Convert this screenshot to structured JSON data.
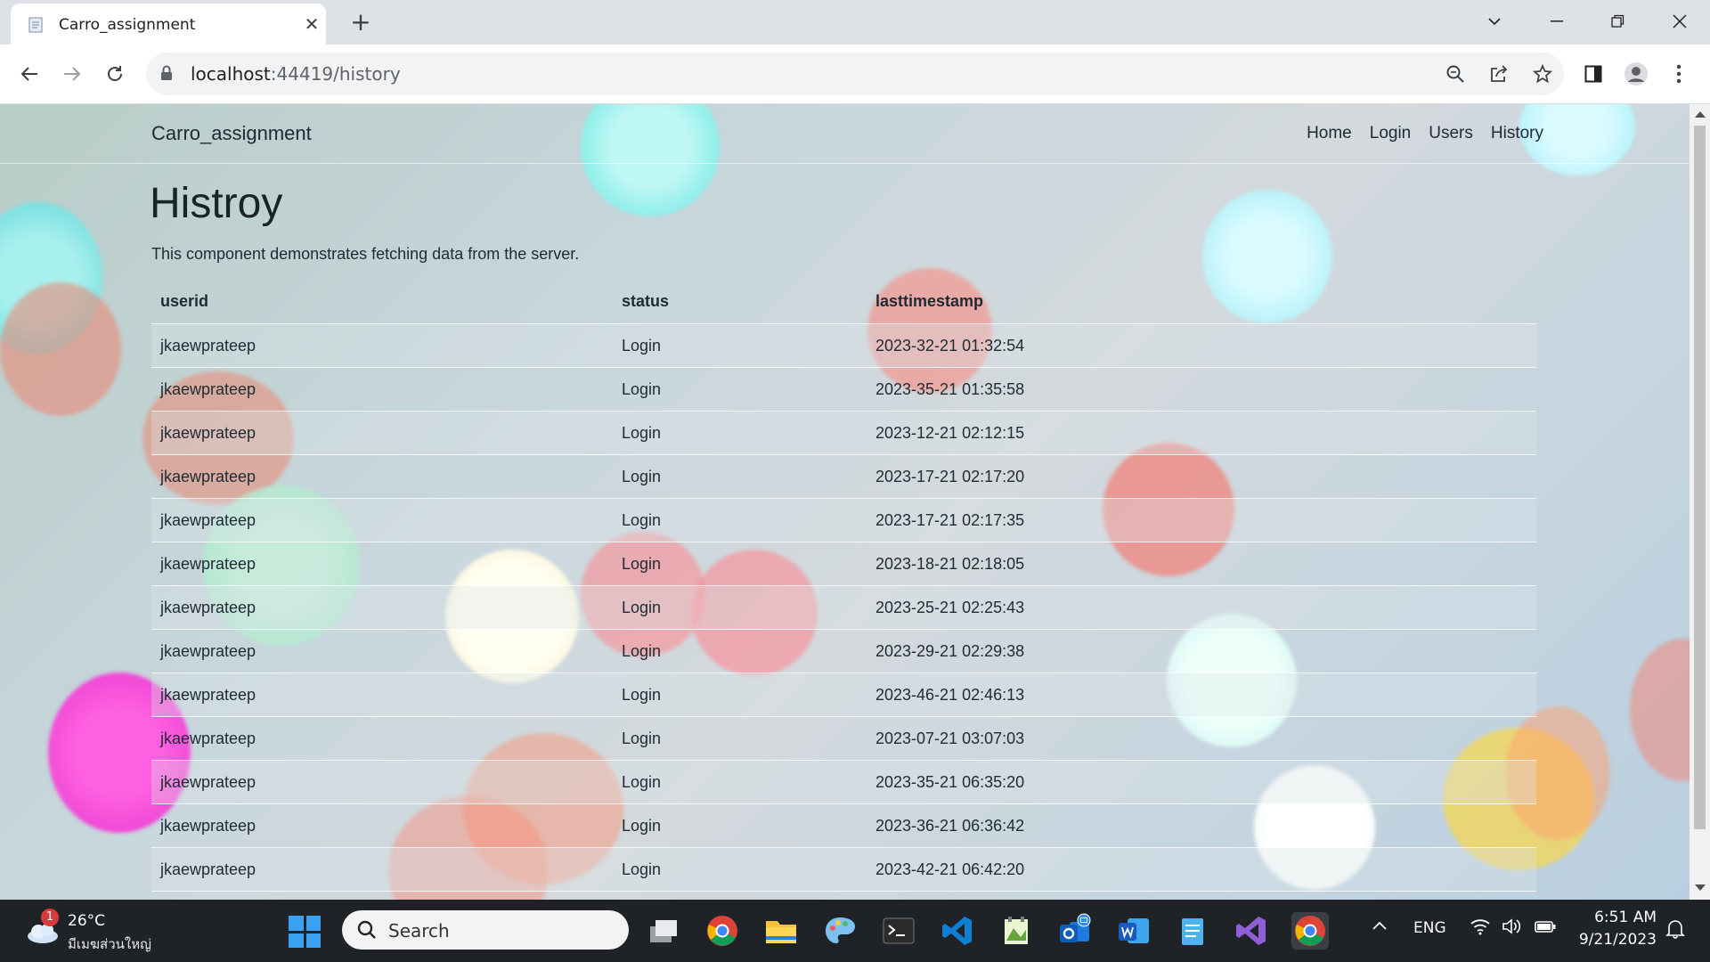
{
  "browser": {
    "tab_title": "Carro_assignment",
    "url_host": "localhost",
    "url_path": ":44419/history"
  },
  "site": {
    "brand": "Carro_assignment",
    "nav": [
      "Home",
      "Login",
      "Users",
      "History"
    ]
  },
  "page": {
    "title": "Histroy",
    "description": "This component demonstrates fetching data from the server."
  },
  "table": {
    "headers": [
      "userid",
      "status",
      "lasttimestamp"
    ],
    "rows": [
      [
        "jkaewprateep",
        "Login",
        "2023-32-21 01:32:54"
      ],
      [
        "jkaewprateep",
        "Login",
        "2023-35-21 01:35:58"
      ],
      [
        "jkaewprateep",
        "Login",
        "2023-12-21 02:12:15"
      ],
      [
        "jkaewprateep",
        "Login",
        "2023-17-21 02:17:20"
      ],
      [
        "jkaewprateep",
        "Login",
        "2023-17-21 02:17:35"
      ],
      [
        "jkaewprateep",
        "Login",
        "2023-18-21 02:18:05"
      ],
      [
        "jkaewprateep",
        "Login",
        "2023-25-21 02:25:43"
      ],
      [
        "jkaewprateep",
        "Login",
        "2023-29-21 02:29:38"
      ],
      [
        "jkaewprateep",
        "Login",
        "2023-46-21 02:46:13"
      ],
      [
        "jkaewprateep",
        "Login",
        "2023-07-21 03:07:03"
      ],
      [
        "jkaewprateep",
        "Login",
        "2023-35-21 06:35:20"
      ],
      [
        "jkaewprateep",
        "Login",
        "2023-36-21 06:36:42"
      ],
      [
        "jkaewprateep",
        "Login",
        "2023-42-21 06:42:20"
      ]
    ]
  },
  "taskbar": {
    "weather_badge": "1",
    "weather_temp": "26°C",
    "weather_location": "มีเมฆส่วนใหญ่",
    "search_placeholder": "Search",
    "language": "ENG",
    "time": "6:51 AM",
    "date": "9/21/2023"
  }
}
